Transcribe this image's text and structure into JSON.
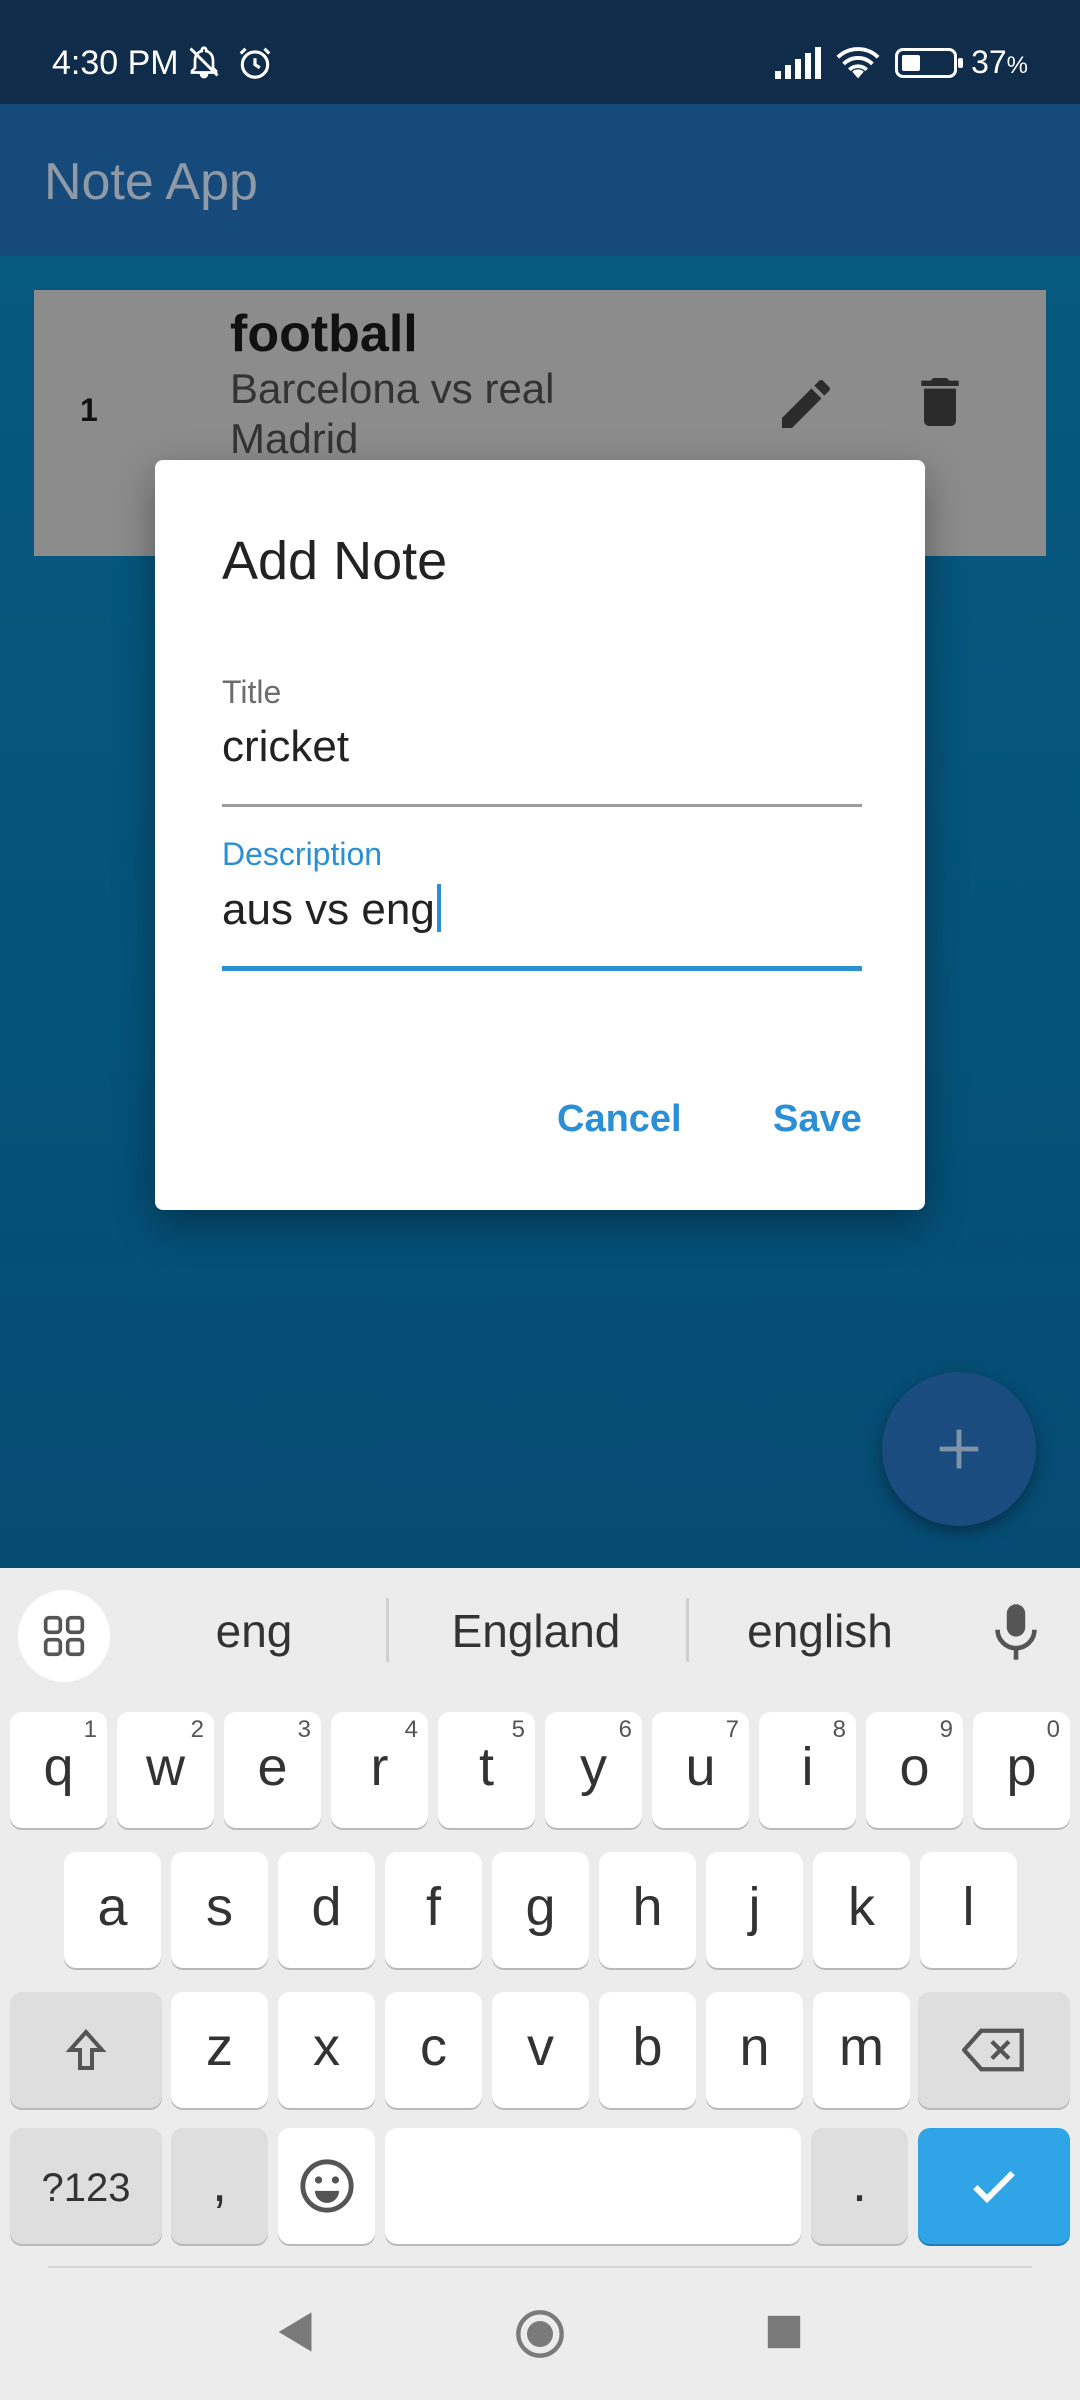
{
  "status_bar": {
    "time": "4:30 PM",
    "battery": "37",
    "battery_unit": "%",
    "battery_level": 0.37,
    "icons": [
      "mute-bell-icon",
      "alarm-icon",
      "signal-icon",
      "wifi-icon",
      "battery-icon"
    ]
  },
  "app_bar": {
    "title": "Note App"
  },
  "notes": [
    {
      "number": "1",
      "title": "football",
      "description": "Barcelona vs real Madrid"
    }
  ],
  "dialog": {
    "title": "Add Note",
    "title_field": {
      "label": "Title",
      "value": "cricket"
    },
    "description_field": {
      "label": "Description",
      "value": "aus vs eng"
    },
    "cancel_label": "Cancel",
    "save_label": "Save"
  },
  "keyboard": {
    "suggestions": [
      "eng",
      "England",
      "english"
    ],
    "row1": [
      {
        "k": "q",
        "n": "1"
      },
      {
        "k": "w",
        "n": "2"
      },
      {
        "k": "e",
        "n": "3"
      },
      {
        "k": "r",
        "n": "4"
      },
      {
        "k": "t",
        "n": "5"
      },
      {
        "k": "y",
        "n": "6"
      },
      {
        "k": "u",
        "n": "7"
      },
      {
        "k": "i",
        "n": "8"
      },
      {
        "k": "o",
        "n": "9"
      },
      {
        "k": "p",
        "n": "0"
      }
    ],
    "row2": [
      "a",
      "s",
      "d",
      "f",
      "g",
      "h",
      "j",
      "k",
      "l"
    ],
    "row3": [
      "z",
      "x",
      "c",
      "v",
      "b",
      "n",
      "m"
    ],
    "symbols_label": "?123",
    "comma": ",",
    "period": "."
  },
  "colors": {
    "accent": "#2b8fd6",
    "app_bar": "#154a7a",
    "enter_key": "#2fa4e7"
  }
}
